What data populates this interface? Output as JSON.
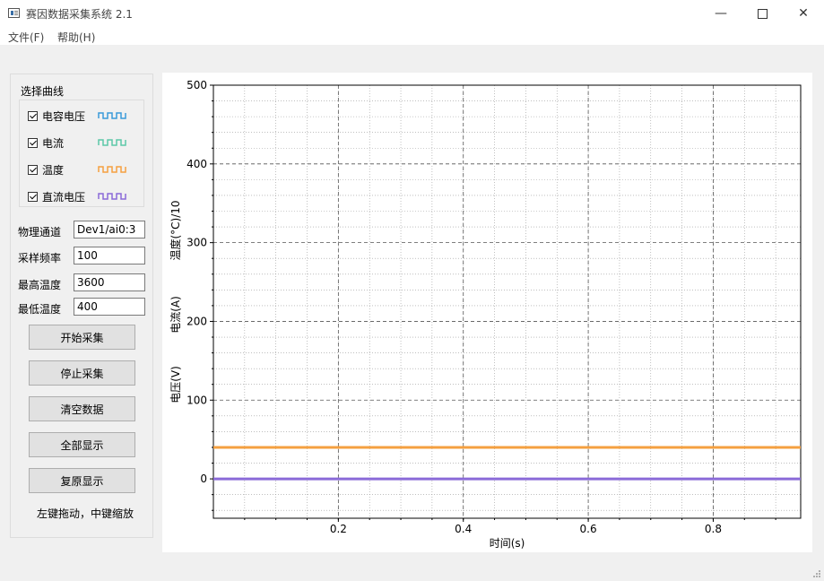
{
  "window": {
    "title": "赛因数据采集系统 2.1"
  },
  "menu": {
    "file": "文件(F)",
    "help": "帮助(H)"
  },
  "curves": {
    "title": "选择曲线",
    "items": [
      {
        "label": "电容电压",
        "color": "#3a9ad9",
        "checked": true
      },
      {
        "label": "电流",
        "color": "#5cc8a8",
        "checked": true
      },
      {
        "label": "温度",
        "color": "#f5a040",
        "checked": true
      },
      {
        "label": "直流电压",
        "color": "#8a6ad8",
        "checked": true
      }
    ]
  },
  "fields": [
    {
      "label": "物理通道",
      "value": "Dev1/ai0:3"
    },
    {
      "label": "采样频率",
      "value": "100"
    },
    {
      "label": "最高温度",
      "value": "3600"
    },
    {
      "label": "最低温度",
      "value": "400"
    }
  ],
  "buttons": {
    "start": "开始采集",
    "stop": "停止采集",
    "clear": "清空数据",
    "show_all": "全部显示",
    "reset": "复原显示"
  },
  "hint": "左键拖动，中键缩放",
  "chart_data": {
    "type": "line",
    "xlabel": "时间(s)",
    "ylabels": [
      "温度(°C)/10",
      "电流(A)",
      "电压(V)"
    ],
    "xlim": [
      0,
      0.94
    ],
    "ylim": [
      -50,
      500
    ],
    "x_ticks": [
      0.2,
      0.4,
      0.6,
      0.8
    ],
    "y_ticks": [
      0,
      100,
      200,
      300,
      400,
      500
    ],
    "grid": true,
    "series": [
      {
        "color": "#f5a040",
        "x": [
          0,
          0.94
        ],
        "y": [
          40,
          40
        ]
      },
      {
        "color": "#8a6ad8",
        "x": [
          0,
          0.94
        ],
        "y": [
          0,
          0
        ]
      }
    ]
  }
}
